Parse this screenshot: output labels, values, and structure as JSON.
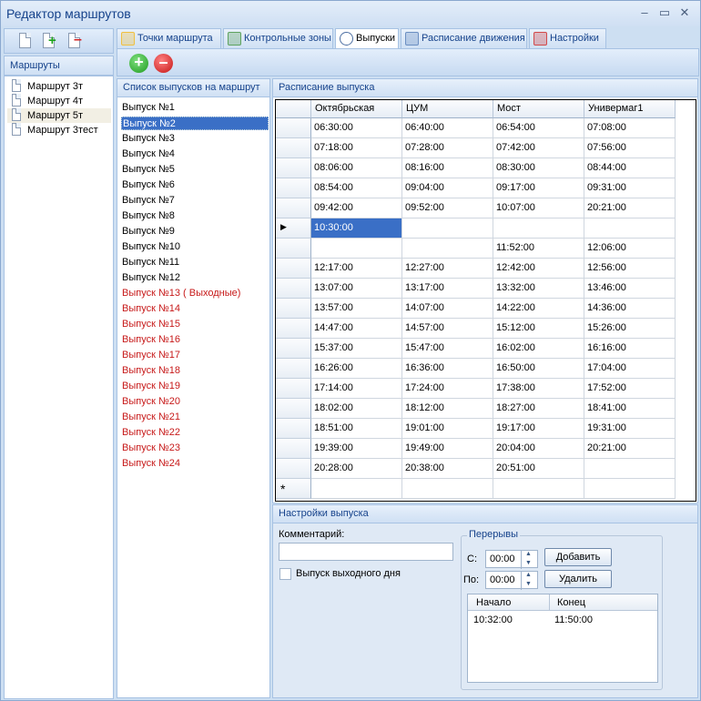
{
  "window": {
    "title": "Редактор маршрутов"
  },
  "routes_panel": {
    "header": "Маршруты",
    "items": [
      "Маршрут 3т",
      "Маршрут 4т",
      "Маршрут 5т",
      "Маршрут 3тест"
    ],
    "selected_index": 2
  },
  "tabs": [
    {
      "label": "Точки маршрута"
    },
    {
      "label": "Контрольные зоны"
    },
    {
      "label": "Выпуски",
      "active": true
    },
    {
      "label": "Расписание движения"
    },
    {
      "label": "Настройки"
    }
  ],
  "vypusk_list": {
    "header": "Список выпусков на маршрут",
    "selected_index": 1,
    "items": [
      {
        "label": "Выпуск №1",
        "red": false
      },
      {
        "label": "Выпуск №2",
        "red": false
      },
      {
        "label": "Выпуск №3",
        "red": false
      },
      {
        "label": "Выпуск №4",
        "red": false
      },
      {
        "label": "Выпуск №5",
        "red": false
      },
      {
        "label": "Выпуск №6",
        "red": false
      },
      {
        "label": "Выпуск №7",
        "red": false
      },
      {
        "label": "Выпуск №8",
        "red": false
      },
      {
        "label": "Выпуск №9",
        "red": false
      },
      {
        "label": "Выпуск №10",
        "red": false
      },
      {
        "label": "Выпуск №11",
        "red": false
      },
      {
        "label": "Выпуск №12",
        "red": false
      },
      {
        "label": "Выпуск №13 ( Выходные)",
        "red": true
      },
      {
        "label": "Выпуск №14",
        "red": true
      },
      {
        "label": "Выпуск №15",
        "red": true
      },
      {
        "label": "Выпуск №16",
        "red": true
      },
      {
        "label": "Выпуск №17",
        "red": true
      },
      {
        "label": "Выпуск №18",
        "red": true
      },
      {
        "label": "Выпуск №19",
        "red": true
      },
      {
        "label": "Выпуск №20",
        "red": true
      },
      {
        "label": "Выпуск №21",
        "red": true
      },
      {
        "label": "Выпуск №22",
        "red": true
      },
      {
        "label": "Выпуск №23",
        "red": true
      },
      {
        "label": "Выпуск №24",
        "red": true
      }
    ]
  },
  "schedule": {
    "header": "Расписание выпуска",
    "columns": [
      "Октябрьская",
      "ЦУМ",
      "Мост",
      "Универмаг1"
    ],
    "rows": [
      [
        "06:30:00",
        "06:40:00",
        "06:54:00",
        "07:08:00"
      ],
      [
        "07:18:00",
        "07:28:00",
        "07:42:00",
        "07:56:00"
      ],
      [
        "08:06:00",
        "08:16:00",
        "08:30:00",
        "08:44:00"
      ],
      [
        "08:54:00",
        "09:04:00",
        "09:17:00",
        "09:31:00"
      ],
      [
        "09:42:00",
        "09:52:00",
        "10:07:00",
        "20:21:00"
      ],
      [
        "10:30:00",
        "",
        "",
        ""
      ],
      [
        "",
        "",
        "11:52:00",
        "12:06:00"
      ],
      [
        "12:17:00",
        "12:27:00",
        "12:42:00",
        "12:56:00"
      ],
      [
        "13:07:00",
        "13:17:00",
        "13:32:00",
        "13:46:00"
      ],
      [
        "13:57:00",
        "14:07:00",
        "14:22:00",
        "14:36:00"
      ],
      [
        "14:47:00",
        "14:57:00",
        "15:12:00",
        "15:26:00"
      ],
      [
        "15:37:00",
        "15:47:00",
        "16:02:00",
        "16:16:00"
      ],
      [
        "16:26:00",
        "16:36:00",
        "16:50:00",
        "17:04:00"
      ],
      [
        "17:14:00",
        "17:24:00",
        "17:38:00",
        "17:52:00"
      ],
      [
        "18:02:00",
        "18:12:00",
        "18:27:00",
        "18:41:00"
      ],
      [
        "18:51:00",
        "19:01:00",
        "19:17:00",
        "19:31:00"
      ],
      [
        "19:39:00",
        "19:49:00",
        "20:04:00",
        "20:21:00"
      ],
      [
        "20:28:00",
        "20:38:00",
        "20:51:00",
        ""
      ]
    ],
    "current_row_marker": "▶",
    "new_row_marker": "*"
  },
  "settings": {
    "header": "Настройки выпуска",
    "comment_label": "Комментарий:",
    "comment_value": "",
    "weekend_checkbox_label": "Выпуск выходного дня",
    "breaks": {
      "title": "Перерывы",
      "from_label": "С:",
      "from_value": "00:00",
      "to_label": "По:",
      "to_value": "00:00",
      "add_button": "Добавить",
      "delete_button": "Удалить",
      "columns": [
        "Начало",
        "Конец"
      ],
      "rows": [
        [
          "10:32:00",
          "11:50:00"
        ]
      ]
    }
  }
}
